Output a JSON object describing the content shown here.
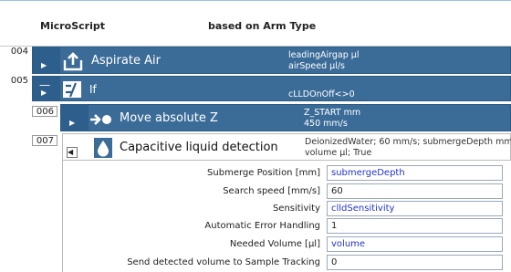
{
  "header": {
    "name": "MicroScript",
    "based_on": "based on Arm Type"
  },
  "steps": [
    {
      "line": "004",
      "title": "Aspirate Air",
      "params": [
        "leadingAirgap µl",
        "airSpeed µl/s"
      ],
      "icon": "upload-arrow-icon"
    },
    {
      "line": "005",
      "title": "If",
      "params": [
        "",
        "cLLDOnOff<>0"
      ],
      "icon": "if-condition-icon"
    },
    {
      "line": "006",
      "title": "Move absolute Z",
      "params": [
        "Z_START mm",
        "450 mm/s"
      ],
      "icon": "move-arrow-icon"
    },
    {
      "line": "007",
      "title": "Capacitive liquid detection",
      "params": [
        "DeionizedWater; 60 mm/s; submergeDepth mm",
        "volume µl; True"
      ],
      "icon": "liquid-drop-icon"
    }
  ],
  "form": {
    "fields": [
      {
        "label": "Submerge Position [mm]",
        "value": "submergeDepth",
        "kind": "variable"
      },
      {
        "label": "Search speed [mm/s]",
        "value": "60",
        "kind": "literal"
      },
      {
        "label": "Sensitivity",
        "value": "clldSensitivity",
        "kind": "variable"
      },
      {
        "label": "Automatic Error Handling",
        "value": "1",
        "kind": "literal"
      },
      {
        "label": "Needed Volume [µl]",
        "value": "volume",
        "kind": "variable"
      },
      {
        "label": "Send detected volume to Sample Tracking",
        "value": "0",
        "kind": "literal"
      }
    ]
  },
  "colors": {
    "step_bg": "#3b6c98",
    "step_bar": "#2e5f8c",
    "variable_text": "#2233cc",
    "header_rule": "#9dc3e6"
  }
}
